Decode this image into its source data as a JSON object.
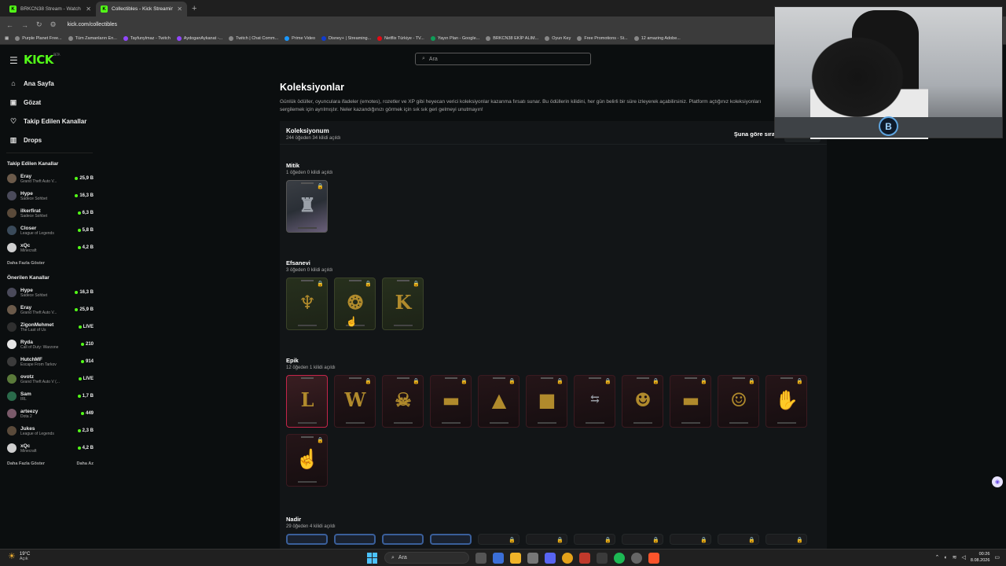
{
  "browser": {
    "tabs": [
      {
        "title": "BRKCN38 Stream - Watch Live o"
      },
      {
        "title": "Collectibles - Kick Streaming"
      }
    ],
    "new_tab": "+",
    "url": "kick.com/collectibles",
    "bookmarks": [
      "Purple Planet Free...",
      "Tüm Zamanların En...",
      "Tayfunylmaz - Twitch",
      "AydoganAykanat -...",
      "Twitch | Chat Comm...",
      "Prime Video",
      "Disney+ | Streaming...",
      "Netflix Türkiye - TV...",
      "Yayın Plan - Google...",
      "BRKCN38 EKİP ALIM...",
      "Oyun Key",
      "Free Promotions - St...",
      "12 amazing Adobe..."
    ]
  },
  "header": {
    "logo": "KICK",
    "logo_badge": "BETA",
    "search_placeholder": "Ara"
  },
  "sidebar": {
    "nav": [
      {
        "label": "Ana Sayfa",
        "icon": "home-icon"
      },
      {
        "label": "Gözat",
        "icon": "compass-icon"
      },
      {
        "label": "Takip Edilen Kanallar",
        "icon": "heart-icon"
      },
      {
        "label": "Drops",
        "icon": "drops-icon"
      }
    ],
    "followed_heading": "Takip Edilen Kanallar",
    "followed": [
      {
        "name": "Eray",
        "game": "Grand Theft Auto V...",
        "viewers": "25,9 B"
      },
      {
        "name": "Hype",
        "game": "Sadece Sohbet",
        "viewers": "16,3 B"
      },
      {
        "name": "ilkerfirat",
        "game": "Sadece Sohbet",
        "viewers": "6,3 B"
      },
      {
        "name": "Closer",
        "game": "League of Legends",
        "viewers": "5,8 B"
      },
      {
        "name": "xQc",
        "game": "Minecraft",
        "viewers": "4,2 B"
      }
    ],
    "show_more": "Daha Fazla Göster",
    "recommended_heading": "Önerilen Kanallar",
    "recommended": [
      {
        "name": "Hype",
        "game": "Sadece Sohbet",
        "viewers": "16,3 B"
      },
      {
        "name": "Eray",
        "game": "Grand Theft Auto V...",
        "viewers": "25,9 B"
      },
      {
        "name": "ZigonMehmet",
        "game": "The Last of Us",
        "viewers": "LIVE"
      },
      {
        "name": "Ryda",
        "game": "Call of Duty: Warzone",
        "viewers": "210"
      },
      {
        "name": "HutchMF",
        "game": "Escape From Tarkov",
        "viewers": "914"
      },
      {
        "name": "ovotz",
        "game": "Grand Theft Auto V (...",
        "viewers": "LIVE"
      },
      {
        "name": "Sam",
        "game": "IRL",
        "viewers": "1,7 B"
      },
      {
        "name": "arteezy",
        "game": "Dota 2",
        "viewers": "449"
      },
      {
        "name": "Jukes",
        "game": "League of Legends",
        "viewers": "2,3 B"
      },
      {
        "name": "xQc",
        "game": "Minecraft",
        "viewers": "4,2 B"
      }
    ],
    "show_more_2": "Daha Fazla Göster",
    "show_less": "Daha Az"
  },
  "main": {
    "title": "Koleksiyonlar",
    "description": "Günlük ödüller, oyunculara ifadeler (emotes), rozetler ve XP gibi heyecan verici koleksiyonlar kazanma fırsatı sunar. Bu ödüllerin kilidini, her gün belirli bir süre izleyerek açabilirsiniz. Platform açtığınız koleksiyonları sergilemek için ayrılmıştır. Neler kazandığınızı görmek için sık sık geri gelmeyi unutmayın!",
    "panel_title": "Koleksiyonum",
    "panel_subtitle": "244 öğeden 34 kilidi açıldı",
    "sort_label": "Şuna göre sıra",
    "sections": [
      {
        "title": "Mitik",
        "subtitle": "1 öğeden 0 kilidi açıldı"
      },
      {
        "title": "Efsanevi",
        "subtitle": "3 öğeden 0 kilidi açıldı"
      },
      {
        "title": "Epik",
        "subtitle": "12 öğeden 1 kilidi açıldı"
      },
      {
        "title": "Nadir",
        "subtitle": "29 öğeden 4 kilidi açıldı"
      }
    ],
    "epic_letters": [
      "L",
      "W"
    ],
    "legend_letter": "K"
  },
  "taskbar": {
    "weather_temp": "19°C",
    "weather_text": "Açık",
    "search": "Ara",
    "time": "00:26",
    "date": "8.08.2026"
  },
  "webcam_logo": "B"
}
